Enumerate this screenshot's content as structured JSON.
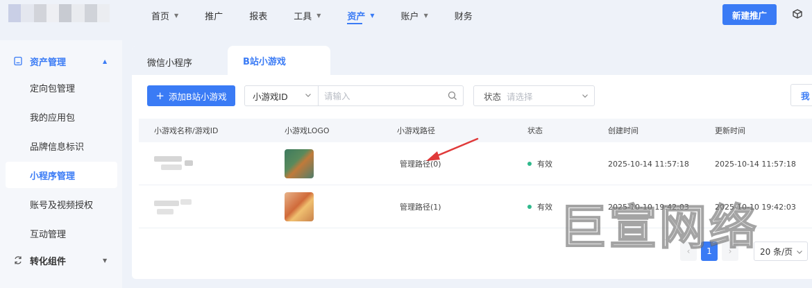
{
  "colors": {
    "accent": "#3a7bf5",
    "status_ok": "#2fb98c",
    "page_bg": "#eef2f9"
  },
  "nav": {
    "items": [
      {
        "label": "首页",
        "caret": true
      },
      {
        "label": "推广",
        "caret": false
      },
      {
        "label": "报表",
        "caret": false
      },
      {
        "label": "工具",
        "caret": true
      },
      {
        "label": "资产",
        "caret": true,
        "active": true
      },
      {
        "label": "账户",
        "caret": true
      },
      {
        "label": "财务",
        "caret": false
      }
    ],
    "new_button": "新建推广",
    "right_icon": "box-icon"
  },
  "sidebar": {
    "group1": {
      "label": "资产管理",
      "icon": "file-icon",
      "expanded": true
    },
    "items": [
      {
        "label": "定向包管理"
      },
      {
        "label": "我的应用包"
      },
      {
        "label": "品牌信息标识"
      },
      {
        "label": "小程序管理",
        "active": true
      },
      {
        "label": "账号及视频授权"
      },
      {
        "label": "互动管理"
      }
    ],
    "group2": {
      "label": "转化组件",
      "icon": "convert-icon",
      "expanded": false
    }
  },
  "tabs": [
    {
      "label": "微信小程序",
      "active": false
    },
    {
      "label": "B站小游戏",
      "active": true
    }
  ],
  "toolbar": {
    "add_button": "添加B站小游戏",
    "search_field_select": "小游戏ID",
    "search_placeholder": "请输入",
    "status_label": "状态",
    "status_placeholder": "请选择",
    "right_button": "我"
  },
  "table": {
    "headers": [
      "小游戏名称/游戏ID",
      "小游戏LOGO",
      "小游戏路径",
      "状态",
      "创建时间",
      "更新时间"
    ],
    "rows": [
      {
        "path": "管理路径(0)",
        "status": "有效",
        "created": "2025-10-14 11:57:18",
        "updated": "2025-10-14 11:57:18",
        "logo_colors": [
          "#3d7a5e",
          "#c07a3a"
        ]
      },
      {
        "path": "管理路径(1)",
        "status": "有效",
        "created": "2025-10-10 19:42:03",
        "updated": "2025-10-10 19:42:03",
        "logo_colors": [
          "#e8b48a",
          "#d06a3a"
        ]
      }
    ]
  },
  "pagination": {
    "current": "1",
    "page_size": "20 条/页"
  },
  "watermark": "巨宣网络"
}
